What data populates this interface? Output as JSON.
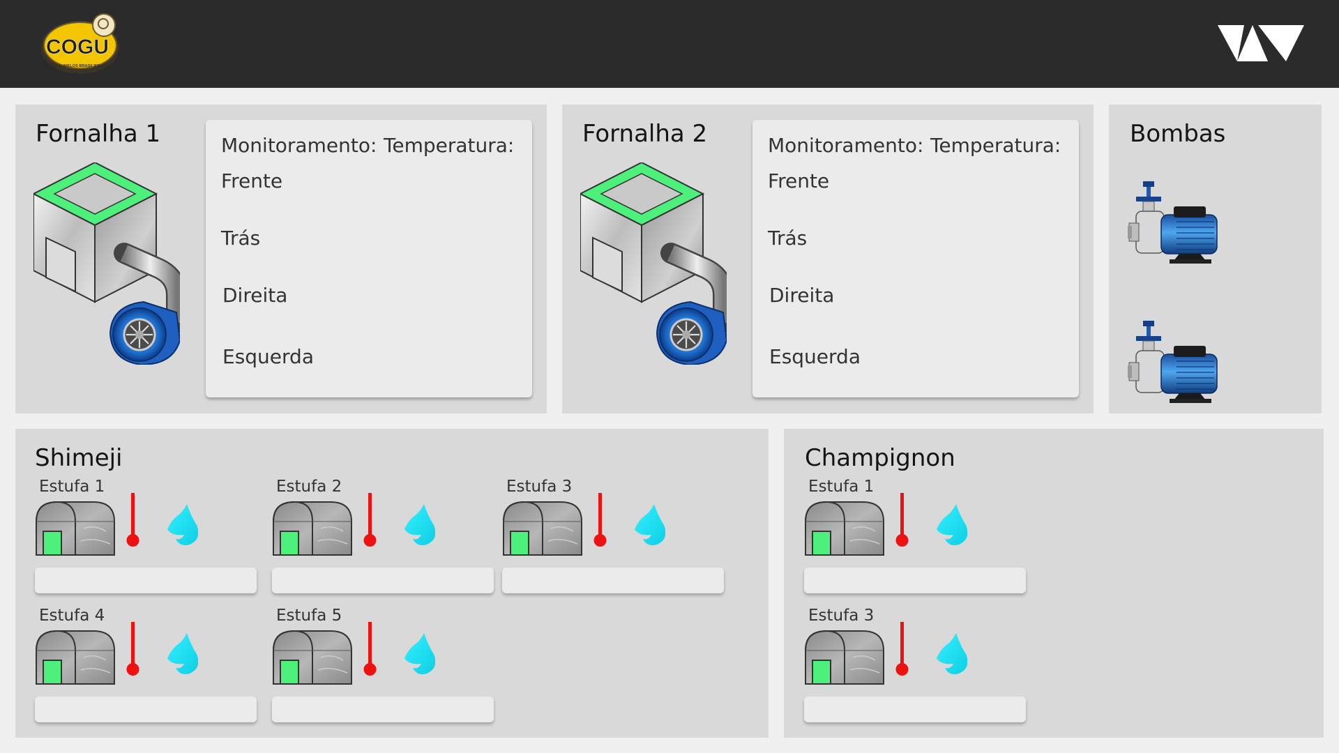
{
  "header": {
    "logo": {
      "text": "COGU",
      "subtext": "COGUMELOS BRASILIENSES"
    }
  },
  "furnaces": [
    {
      "title": "Fornalha 1",
      "monitor_label": "Monitoramento:",
      "temp_label": "Temperatura:",
      "rows": [
        "Frente",
        "Trás",
        "Direita",
        "Esquerda"
      ]
    },
    {
      "title": "Fornalha 2",
      "monitor_label": "Monitoramento:",
      "temp_label": "Temperatura:",
      "rows": [
        "Frente",
        "Trás",
        "Direita",
        "Esquerda"
      ]
    }
  ],
  "pumps": {
    "title": "Bombas"
  },
  "shimeji": {
    "title": "Shimeji",
    "estufas": [
      "Estufa 1",
      "Estufa 2",
      "Estufa 3",
      "Estufa 4",
      "Estufa 5"
    ]
  },
  "champignon": {
    "title": "Champignon",
    "estufas": [
      "Estufa 1",
      "Estufa 3"
    ]
  },
  "colors": {
    "header": "#2b2b2b",
    "panel": "#d9d9d9",
    "card": "#ebebeb",
    "green_accent": "#4cf07a",
    "thermometer": "#ee1111",
    "water_drop": "#1ee6f5",
    "pump_blue": "#1e6fd0",
    "logo_yellow": "#f3c400"
  }
}
